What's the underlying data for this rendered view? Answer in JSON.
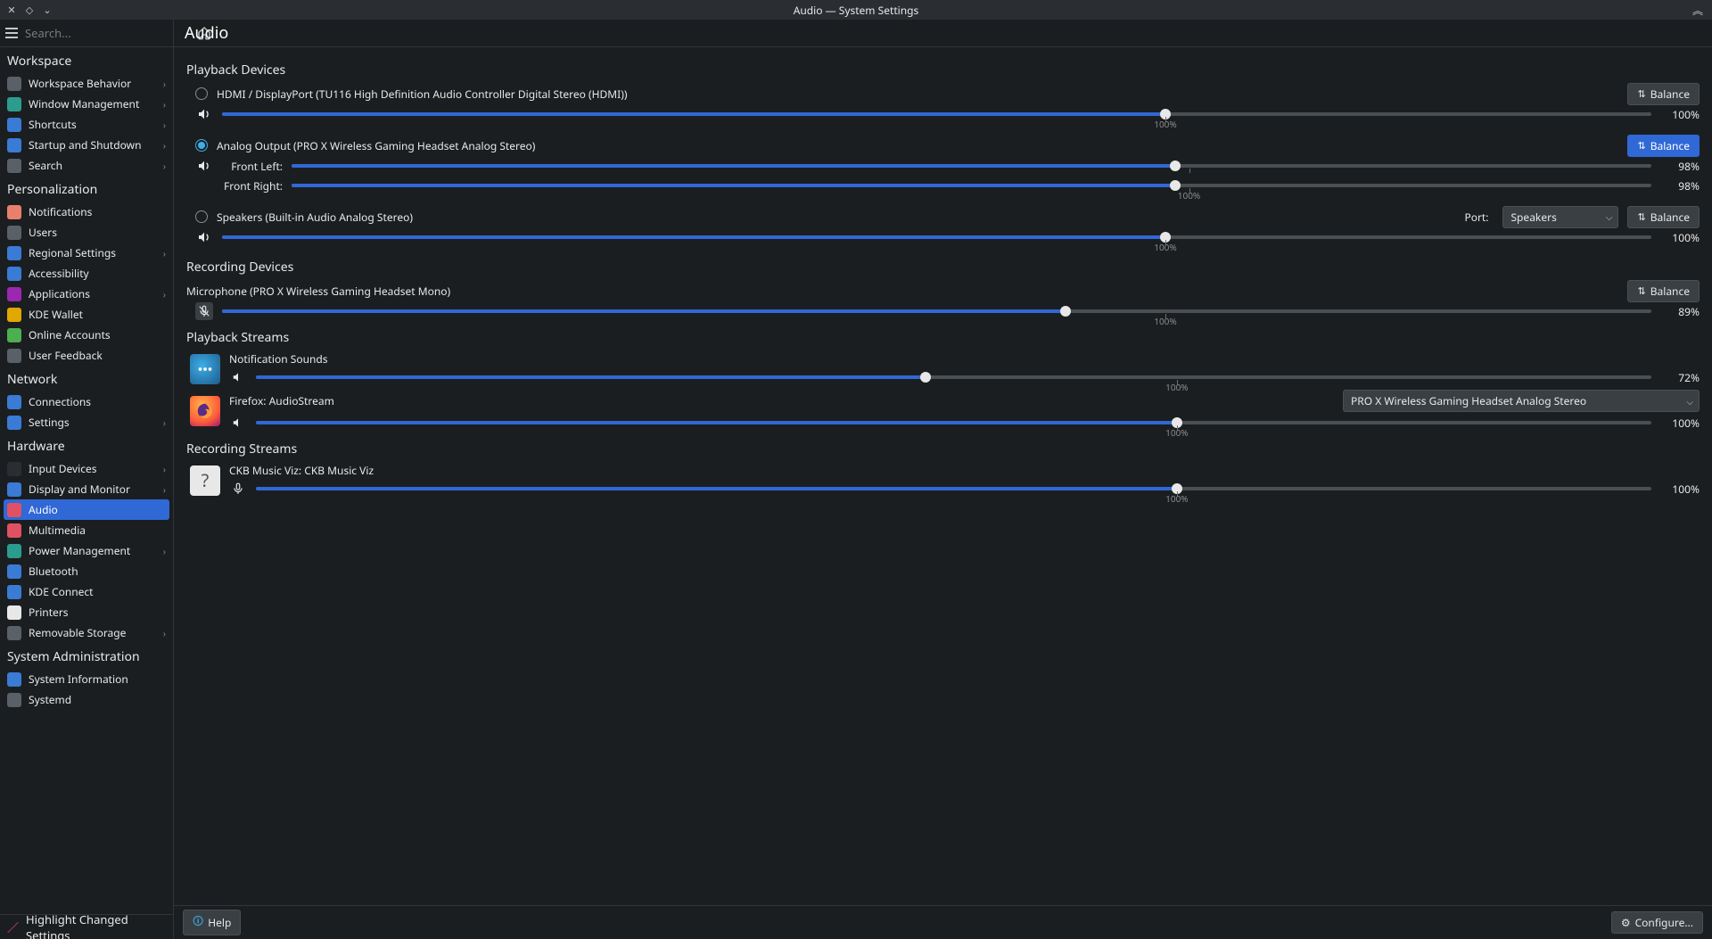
{
  "titlebar": {
    "title": "Audio — System Settings"
  },
  "sidebar": {
    "search_placeholder": "Search...",
    "groups": [
      {
        "label": "Workspace",
        "items": [
          {
            "label": "Workspace Behavior",
            "icon_color": "ic-gear",
            "chev": true
          },
          {
            "label": "Window Management",
            "icon_color": "ic-teal",
            "chev": true
          },
          {
            "label": "Shortcuts",
            "icon_color": "ic-blue",
            "chev": true
          },
          {
            "label": "Startup and Shutdown",
            "icon_color": "ic-blue",
            "chev": true
          },
          {
            "label": "Search",
            "icon_color": "ic-gear",
            "chev": true
          }
        ]
      },
      {
        "label": "Personalization",
        "items": [
          {
            "label": "Notifications",
            "icon_color": "ic-orange",
            "chev": false
          },
          {
            "label": "Users",
            "icon_color": "ic-gear",
            "chev": false
          },
          {
            "label": "Regional Settings",
            "icon_color": "ic-blue",
            "chev": true
          },
          {
            "label": "Accessibility",
            "icon_color": "ic-blue",
            "chev": false
          },
          {
            "label": "Applications",
            "icon_color": "ic-violet",
            "chev": true
          },
          {
            "label": "KDE Wallet",
            "icon_color": "ic-yellow",
            "chev": false
          },
          {
            "label": "Online Accounts",
            "icon_color": "ic-green",
            "chev": false
          },
          {
            "label": "User Feedback",
            "icon_color": "ic-gear",
            "chev": false
          }
        ]
      },
      {
        "label": "Network",
        "items": [
          {
            "label": "Connections",
            "icon_color": "ic-blue",
            "chev": false
          },
          {
            "label": "Settings",
            "icon_color": "ic-blue",
            "chev": true
          }
        ]
      },
      {
        "label": "Hardware",
        "items": [
          {
            "label": "Input Devices",
            "icon_color": "ic-dark",
            "chev": true
          },
          {
            "label": "Display and Monitor",
            "icon_color": "ic-blue",
            "chev": true
          },
          {
            "label": "Audio",
            "icon_color": "ic-red",
            "chev": false,
            "active": true
          },
          {
            "label": "Multimedia",
            "icon_color": "ic-red",
            "chev": false
          },
          {
            "label": "Power Management",
            "icon_color": "ic-teal",
            "chev": true
          },
          {
            "label": "Bluetooth",
            "icon_color": "ic-blue",
            "chev": false
          },
          {
            "label": "KDE Connect",
            "icon_color": "ic-blue",
            "chev": false
          },
          {
            "label": "Printers",
            "icon_color": "ic-white",
            "chev": false
          },
          {
            "label": "Removable Storage",
            "icon_color": "ic-gear",
            "chev": true
          }
        ]
      },
      {
        "label": "System Administration",
        "items": [
          {
            "label": "System Information",
            "icon_color": "ic-blue",
            "chev": false
          },
          {
            "label": "Systemd",
            "icon_color": "ic-gear",
            "chev": false
          }
        ]
      }
    ],
    "footer_label": "Highlight Changed Settings"
  },
  "main": {
    "title": "Audio",
    "playback_section": "Playback Devices",
    "recording_section": "Recording Devices",
    "playback_streams_section": "Playback Streams",
    "recording_streams_section": "Recording Streams",
    "balance_label": "Balance",
    "port_label": "Port:",
    "port_value": "Speakers",
    "mark_100": "100%",
    "devices": {
      "hdmi": {
        "name": "HDMI / DisplayPort (TU116 High Definition Audio Controller Digital Stereo (HDMI))",
        "pct": "100%",
        "fill": 66
      },
      "analog": {
        "name": "Analog Output (PRO X Wireless Gaming Headset Analog Stereo)",
        "fl_label": "Front Left:",
        "fr_label": "Front Right:",
        "fl_pct": "98%",
        "fr_pct": "98%",
        "fl_fill": 65,
        "fr_fill": 65
      },
      "speakers": {
        "name": "Speakers (Built-in Audio Analog Stereo)",
        "pct": "100%",
        "fill": 66
      },
      "mic": {
        "name": "Microphone (PRO X Wireless Gaming Headset Mono)",
        "pct": "89%",
        "fill": 59
      }
    },
    "streams": {
      "notif": {
        "name": "Notification Sounds",
        "pct": "72%",
        "fill": 48
      },
      "firefox": {
        "name": "Firefox: AudioStream",
        "pct": "100%",
        "fill": 66,
        "device": "PRO X Wireless Gaming Headset Analog Stereo"
      },
      "ckb": {
        "name": "CKB Music Viz: CKB Music Viz",
        "pct": "100%",
        "fill": 66
      }
    },
    "footer": {
      "help": "Help",
      "configure": "Configure..."
    }
  }
}
